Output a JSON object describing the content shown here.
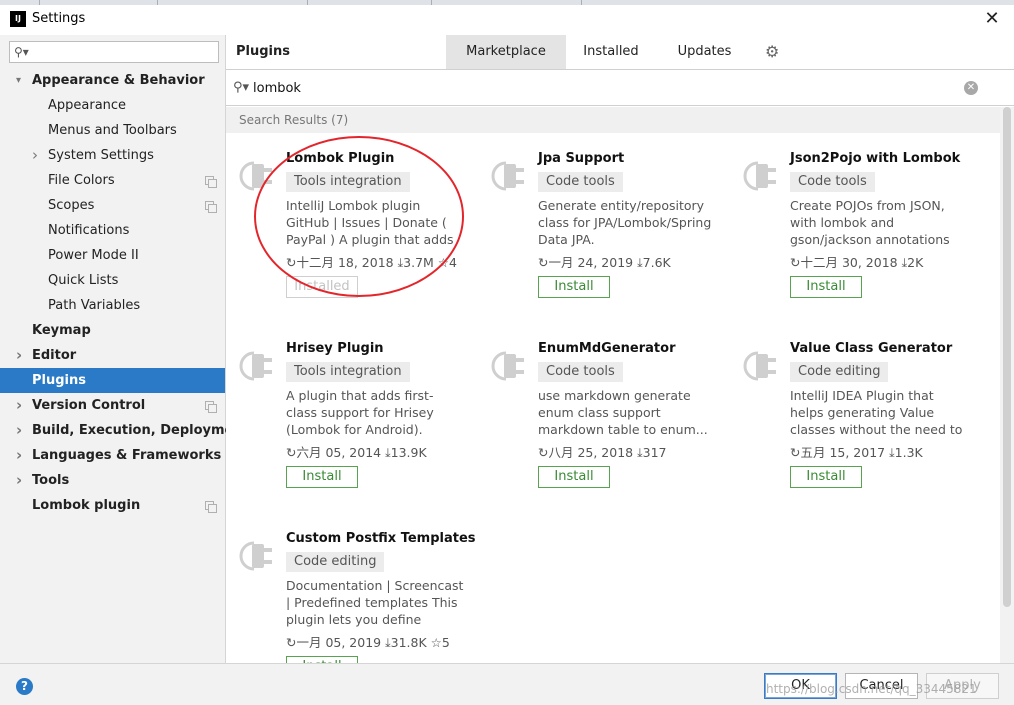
{
  "window": {
    "title": "Settings",
    "icon_text": "IJ"
  },
  "sidebar": {
    "search_placeholder": "",
    "items": [
      {
        "label": "Appearance & Behavior",
        "level": 0,
        "bold": true,
        "expanded": true,
        "arrow": "down"
      },
      {
        "label": "Appearance",
        "level": 1
      },
      {
        "label": "Menus and Toolbars",
        "level": 1
      },
      {
        "label": "System Settings",
        "level": 1,
        "arrow": "right"
      },
      {
        "label": "File Colors",
        "level": 1,
        "copy": true
      },
      {
        "label": "Scopes",
        "level": 1,
        "copy": true
      },
      {
        "label": "Notifications",
        "level": 1
      },
      {
        "label": "Power Mode II",
        "level": 1
      },
      {
        "label": "Quick Lists",
        "level": 1
      },
      {
        "label": "Path Variables",
        "level": 1
      },
      {
        "label": "Keymap",
        "level": 0,
        "bold": true
      },
      {
        "label": "Editor",
        "level": 0,
        "bold": true,
        "arrow": "right"
      },
      {
        "label": "Plugins",
        "level": 0,
        "bold": true,
        "selected": true
      },
      {
        "label": "Version Control",
        "level": 0,
        "bold": true,
        "arrow": "right",
        "copy": true
      },
      {
        "label": "Build, Execution, Deployment",
        "level": 0,
        "bold": true,
        "arrow": "right"
      },
      {
        "label": "Languages & Frameworks",
        "level": 0,
        "bold": true,
        "arrow": "right"
      },
      {
        "label": "Tools",
        "level": 0,
        "bold": true,
        "arrow": "right"
      },
      {
        "label": "Lombok plugin",
        "level": 0,
        "bold": true,
        "copy": true
      }
    ]
  },
  "main": {
    "title": "Plugins",
    "tabs": [
      {
        "label": "Marketplace",
        "active": true
      },
      {
        "label": "Installed"
      },
      {
        "label": "Updates"
      }
    ],
    "search": {
      "value": "lombok",
      "placeholder": ""
    },
    "results_header": "Search Results (7)"
  },
  "plugins": [
    {
      "name": "Lombok Plugin",
      "tag": "Tools integration",
      "desc": "IntelliJ Lombok plugin GitHub | Issues | Donate ( PayPal ) A plugin that adds first-class...",
      "date": "十二月 18, 2018",
      "downloads": "3.7M",
      "rating": "4",
      "button": "Installed",
      "installed": true
    },
    {
      "name": "Jpa Support",
      "tag": "Code tools",
      "desc": "Generate entity/repository class for JPA/Lombok/Spring Data JPA.",
      "date": "一月 24, 2019",
      "downloads": "7.6K",
      "rating": "",
      "button": "Install"
    },
    {
      "name": "Json2Pojo with Lombok",
      "tag": "Code tools",
      "desc": "Create POJOs from JSON, with lombok and gson/jackson annotations and...",
      "date": "十二月 30, 2018",
      "downloads": "2K",
      "rating": "",
      "button": "Install"
    },
    {
      "name": "Hrisey Plugin",
      "tag": "Tools integration",
      "desc": "A plugin that adds first-class support for Hrisey (Lombok for Android).",
      "date": "六月 05, 2014",
      "downloads": "13.9K",
      "rating": "",
      "button": "Install"
    },
    {
      "name": "EnumMdGenerator",
      "tag": "Code tools",
      "desc": "use markdown generate enum class support markdown table to enum...",
      "date": "八月 25, 2018",
      "downloads": "317",
      "rating": "",
      "button": "Install"
    },
    {
      "name": "Value Class Generator",
      "tag": "Code editing",
      "desc": "IntelliJ IDEA Plugin that helps generating Value classes without the need to add any...",
      "date": "五月 15, 2017",
      "downloads": "1.3K",
      "rating": "",
      "button": "Install"
    },
    {
      "name": "Custom Postfix Templates",
      "tag": "Code editing",
      "desc": "Documentation | Screencast | Predefined templates This plugin lets you define your...",
      "date": "一月 05, 2019",
      "downloads": "31.8K",
      "rating": "5",
      "button": "Install"
    }
  ],
  "footer": {
    "help": "?",
    "ok": "OK",
    "cancel": "Cancel",
    "apply": "Apply",
    "watermark": "https://blog.csdn.net/qq_33445821"
  },
  "colors": {
    "accent": "#2a7ac7",
    "install_green": "#57a350",
    "annotation_red": "#e3262b"
  },
  "icons": [
    "search-icon",
    "close-icon",
    "gear-icon",
    "clear-search-icon",
    "plugin-icon",
    "refresh-icon",
    "download-icon",
    "star-icon",
    "help-icon",
    "copy-icon",
    "chevron-right-icon",
    "chevron-down-icon"
  ]
}
